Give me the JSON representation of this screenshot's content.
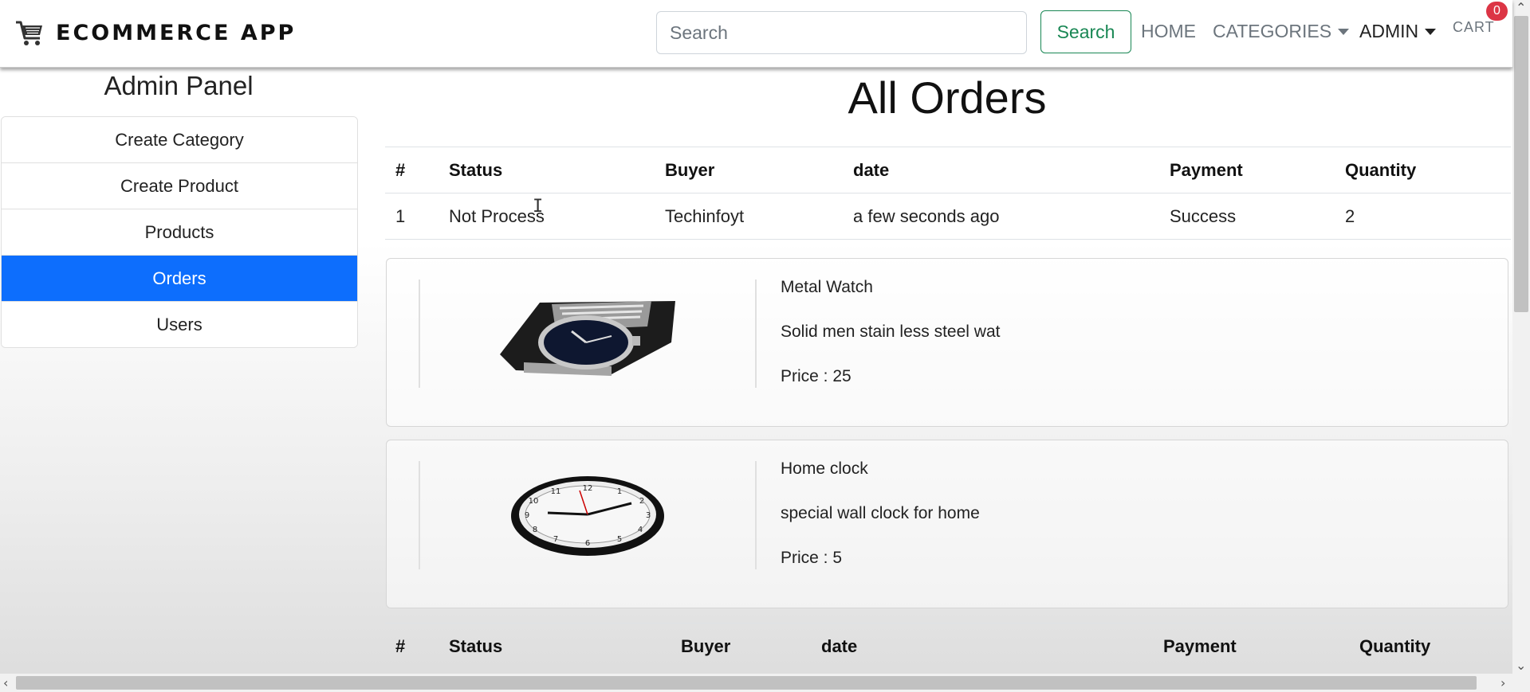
{
  "navbar": {
    "brand": "ECOMMERCE APP",
    "brand_icon": "shopping-cart-icon",
    "search_placeholder": "Search",
    "search_button": "Search",
    "links": {
      "home": "HOME",
      "categories": "CATEGORIES",
      "admin": "ADMIN",
      "cart": "CART"
    },
    "cart_count": "0"
  },
  "sidebar": {
    "title": "Admin Panel",
    "items": [
      {
        "label": "Create Category",
        "active": false
      },
      {
        "label": "Create Product",
        "active": false
      },
      {
        "label": "Products",
        "active": false
      },
      {
        "label": "Orders",
        "active": true
      },
      {
        "label": "Users",
        "active": false
      }
    ]
  },
  "main": {
    "title": "All Orders",
    "table_headers": [
      "#",
      "Status",
      "Buyer",
      "date",
      "Payment",
      "Quantity"
    ],
    "orders": [
      {
        "index": "1",
        "status": "Not Process",
        "buyer": "Techinfoyt",
        "date": "a few seconds ago",
        "payment": "Success",
        "quantity": "2",
        "products": [
          {
            "name": "Metal Watch",
            "description": "Solid men stain less steel wat",
            "price": "Price : 25",
            "image_icon": "wrist-watch-image"
          },
          {
            "name": "Home clock",
            "description": "special wall clock for home",
            "price": "Price : 5",
            "image_icon": "wall-clock-image"
          }
        ]
      }
    ]
  },
  "colors": {
    "accent": "#0d6efd",
    "search_button": "#198754",
    "badge": "#dc3545"
  }
}
